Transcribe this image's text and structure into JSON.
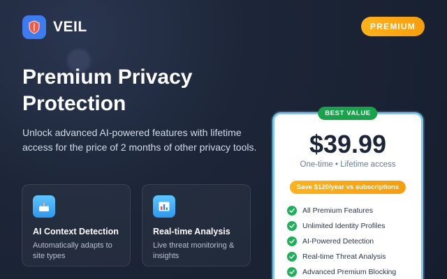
{
  "brand": {
    "name": "VEIL",
    "logo_icon": "shield-logo-icon"
  },
  "header": {
    "badge": "PREMIUM"
  },
  "hero": {
    "title": "Premium Privacy Protection",
    "subtitle": "Unlock advanced AI-powered features with lifetime access for the price of 2 months of other privacy tools."
  },
  "features": [
    {
      "icon": "cake-icon",
      "title": "AI Context Detection",
      "description": "Automatically adapts to site types"
    },
    {
      "icon": "bar-chart-icon",
      "title": "Real-time Analysis",
      "description": "Live threat monitoring & insights"
    }
  ],
  "pricing": {
    "badge": "BEST VALUE",
    "price": "$39.99",
    "note": "One-time • Lifetime access",
    "savings": "Save $120/year vs subscriptions",
    "features": [
      "All Premium Features",
      "Unlimited Identity Profiles",
      "AI-Powered Detection",
      "Real-time Threat Analysis",
      "Advanced Premium Blocking"
    ]
  },
  "colors": {
    "accent": "#f59e0b",
    "brand_blue": "#3d7bf0",
    "success": "#16a34a",
    "card_border": "#7cc8ef"
  }
}
